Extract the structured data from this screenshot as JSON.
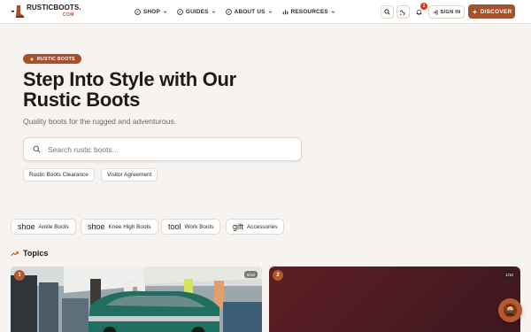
{
  "brand": {
    "name": "RUSTICBOOTS.",
    "suffix": "COM"
  },
  "nav": [
    {
      "label": "SHOP",
      "icon": "compass-icon"
    },
    {
      "label": "GUIDES",
      "icon": "compass-icon"
    },
    {
      "label": "ABOUT US",
      "icon": "compass-icon"
    },
    {
      "label": "RESOURCES",
      "icon": "bar-chart-icon"
    }
  ],
  "header_actions": {
    "search_icon": "search-icon",
    "theme_icon": "moon-icon",
    "notification_count": "1",
    "signin_label": "SIGN IN",
    "discover_label": "DISCOVER"
  },
  "hero": {
    "badge": "RUSTIC BOOTS",
    "title": "Step Into Style with Our Rustic Boots",
    "subtitle": "Quality boots for the rugged and adventurous.",
    "search_placeholder": "Search rustic boots...",
    "quick_links": [
      "Rustic Boots Clearance",
      "Visitor Agreement"
    ]
  },
  "categories": [
    {
      "icon": "shoe",
      "label": "Ankle Boots"
    },
    {
      "icon": "shoe",
      "label": "Knee High Boots"
    },
    {
      "icon": "tool",
      "label": "Work Boots"
    },
    {
      "icon": "gift",
      "label": "Accessories"
    }
  ],
  "topics": {
    "heading": "Topics",
    "cards": [
      {
        "number": "1",
        "count": "8/10"
      },
      {
        "number": "2",
        "count": "1/10"
      }
    ]
  },
  "colors": {
    "accent": "#a8502b",
    "background": "#f6f3f1",
    "badge_red": "#d9361e"
  }
}
